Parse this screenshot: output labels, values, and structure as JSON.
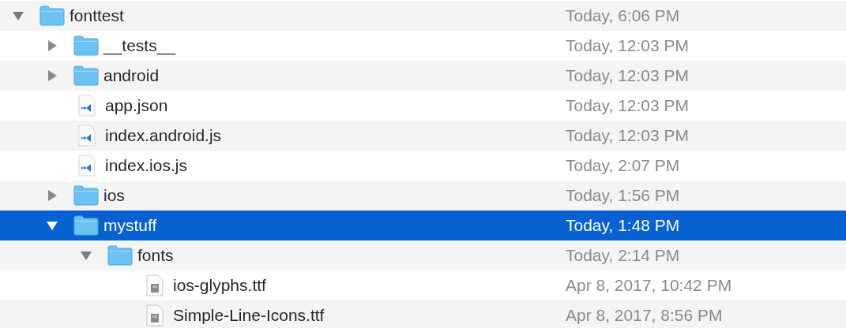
{
  "files": [
    {
      "name": "fonttest",
      "date": "Today, 6:06 PM",
      "kind": "folder",
      "expanded": true,
      "selected": false,
      "children": [
        {
          "name": "__tests__",
          "date": "Today, 12:03 PM",
          "kind": "folder",
          "expanded": false,
          "selected": false
        },
        {
          "name": "android",
          "date": "Today, 12:03 PM",
          "kind": "folder",
          "expanded": false,
          "selected": false
        },
        {
          "name": "app.json",
          "date": "Today, 12:03 PM",
          "kind": "code",
          "selected": false
        },
        {
          "name": "index.android.js",
          "date": "Today, 12:03 PM",
          "kind": "code",
          "selected": false
        },
        {
          "name": "index.ios.js",
          "date": "Today, 2:07 PM",
          "kind": "code",
          "selected": false
        },
        {
          "name": "ios",
          "date": "Today, 1:56 PM",
          "kind": "folder",
          "expanded": false,
          "selected": false
        },
        {
          "name": "mystuff",
          "date": "Today, 1:48 PM",
          "kind": "folder",
          "expanded": true,
          "selected": true,
          "children": [
            {
              "name": "fonts",
              "date": "Today, 2:14 PM",
              "kind": "folder",
              "expanded": true,
              "selected": false,
              "children": [
                {
                  "name": "ios-glyphs.ttf",
                  "date": "Apr 8, 2017, 10:42 PM",
                  "kind": "font",
                  "selected": false
                },
                {
                  "name": "Simple-Line-Icons.ttf",
                  "date": "Apr 8, 2017, 8:56 PM",
                  "kind": "font",
                  "selected": false
                }
              ]
            }
          ]
        }
      ]
    }
  ]
}
